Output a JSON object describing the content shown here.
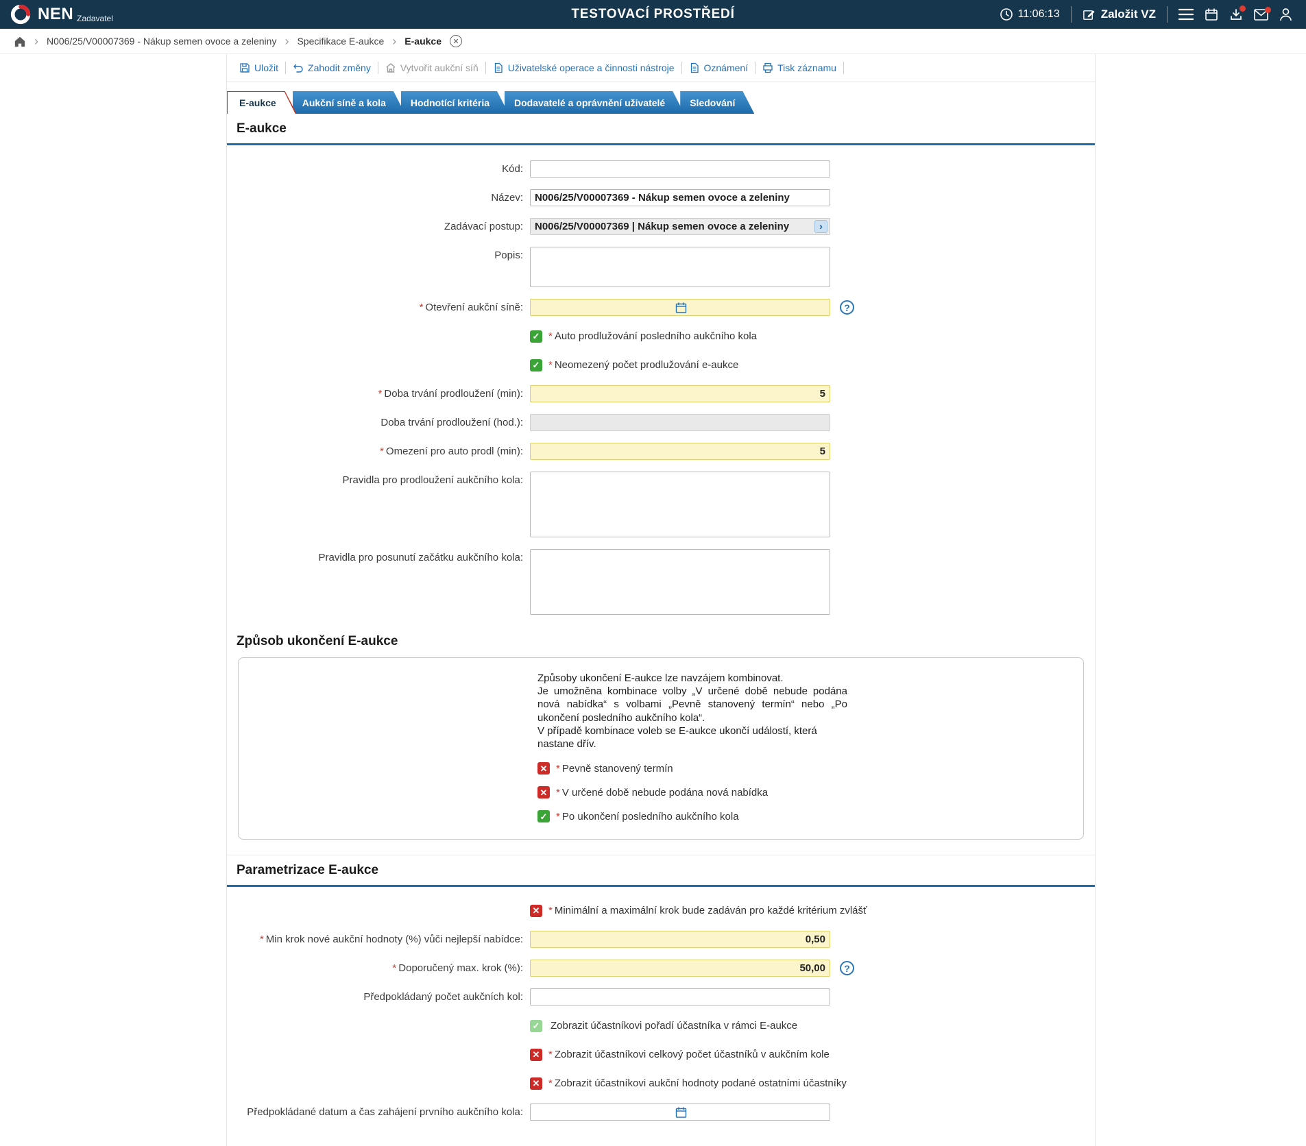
{
  "colors": {
    "header_bg": "#16364e",
    "accent_blue": "#1e6aab",
    "link_blue": "#2272b9",
    "active_tab_red": "#c23a2c",
    "required_field_bg": "#fcf5cb",
    "checkbox_yes_green": "#3aa437",
    "checkbox_no_red": "#cd2b27",
    "checkbox_disabled_green": "#97d694",
    "badge_red": "#e03c31"
  },
  "header": {
    "brand": "NEN",
    "brand_sub": "Zadavatel",
    "environment": "TESTOVACÍ PROSTŘEDÍ",
    "time": "11:06:13",
    "create_button": "Založit VZ",
    "icons": [
      "clock-icon",
      "edit-icon",
      "menu-icon",
      "calendar-icon",
      "download-icon",
      "mail-icon",
      "person-icon"
    ],
    "download_badge": true,
    "mail_badge": true
  },
  "breadcrumb": {
    "home_icon": "home-icon",
    "items": [
      {
        "label": "N006/25/V00007369 - Nákup semen ovoce a zeleniny",
        "current": false
      },
      {
        "label": "Specifikace E-aukce",
        "current": false
      },
      {
        "label": "E-aukce",
        "current": true
      }
    ],
    "close_icon": "close-circle-icon"
  },
  "toolbar": {
    "items": [
      {
        "label": "Uložit",
        "icon": "save-icon",
        "disabled": false
      },
      {
        "label": "Zahodit změny",
        "icon": "undo-icon",
        "disabled": false
      },
      {
        "label": "Vytvořit aukční síň",
        "icon": "auction-room-icon",
        "disabled": true
      },
      {
        "label": "Uživatelské operace a činnosti nástroje",
        "icon": "document-icon",
        "disabled": false
      },
      {
        "label": "Oznámení",
        "icon": "document-icon",
        "disabled": false
      },
      {
        "label": "Tisk záznamu",
        "icon": "printer-icon",
        "disabled": false
      }
    ]
  },
  "tabs": [
    {
      "label": "E-aukce",
      "active": true
    },
    {
      "label": "Aukční síně a kola",
      "active": false
    },
    {
      "label": "Hodnotící kritéria",
      "active": false
    },
    {
      "label": "Dodavatelé a oprávnění uživatelé",
      "active": false
    },
    {
      "label": "Sledování",
      "active": false
    }
  ],
  "sections": {
    "eaukce": "E-aukce",
    "zpusob": "Způsob ukončení E-aukce",
    "parametrizace": "Parametrizace E-aukce"
  },
  "fields": {
    "kod": {
      "label": "Kód:",
      "value": ""
    },
    "nazev": {
      "label": "Název:",
      "value": "N006/25/V00007369 - Nákup semen ovoce a zeleniny"
    },
    "zadavaci_postup": {
      "label": "Zadávací postup:",
      "value": "N006/25/V00007369 | Nákup semen ovoce a zeleniny"
    },
    "popis": {
      "label": "Popis:",
      "value": ""
    },
    "otevreni_sine": {
      "label": "Otevření aukční síně:",
      "value": "",
      "required": "*"
    },
    "doba_trvani_min": {
      "label": "Doba trvání prodloužení (min):",
      "value": "5",
      "required": "*"
    },
    "doba_trvani_hod": {
      "label": "Doba trvání prodloužení (hod.):",
      "value": ""
    },
    "omezeni_auto": {
      "label": "Omezení pro auto prodl (min):",
      "value": "5",
      "required": "*"
    },
    "pravidla_prodlouzeni": {
      "label": "Pravidla pro prodloužení aukčního kola:",
      "value": ""
    },
    "pravidla_posunuti": {
      "label": "Pravidla pro posunutí začátku aukčního kola:",
      "value": ""
    },
    "min_krok": {
      "label": "Min krok nové aukční hodnoty (%) vůči nejlepší nabídce:",
      "value": "0,50",
      "required": "*"
    },
    "max_krok": {
      "label": "Doporučený max. krok (%):",
      "value": "50,00",
      "required": "*"
    },
    "pocet_kol": {
      "label": "Předpokládaný počet aukčních kol:",
      "value": ""
    },
    "datum_zahajeni": {
      "label": "Předpokládané datum a čas zahájení prvního aukčního kola:",
      "value": ""
    }
  },
  "checkboxes": {
    "auto_prodl": {
      "label": "Auto prodlužování posledního aukčního kola",
      "state": "yes",
      "required": "*"
    },
    "neomezeny": {
      "label": "Neomezený počet prodlužování e-aukce",
      "state": "yes",
      "required": "*"
    },
    "pevny_termin": {
      "label": "Pevně stanovený termín",
      "state": "no",
      "required": "*"
    },
    "urcena_doba": {
      "label": "V určené době nebude podána nová nabídka",
      "state": "no",
      "required": "*"
    },
    "po_ukonceni": {
      "label": "Po ukončení posledního aukčního kola",
      "state": "yes",
      "required": "*"
    },
    "min_max_krok": {
      "label": "Minimální a maximální krok bude zadáván pro každé kritérium zvlášť",
      "state": "no",
      "required": "*"
    },
    "poradi": {
      "label": "Zobrazit účastníkovi pořadí účastníka v rámci E-aukce",
      "state": "yes-disabled"
    },
    "celkovy_pocet": {
      "label": "Zobrazit účastníkovi celkový počet účastníků v aukčním kole",
      "state": "no",
      "required": "*"
    },
    "aukcni_hodnoty": {
      "label": "Zobrazit účastníkovi aukční hodnoty podané ostatními účastníky",
      "state": "no",
      "required": "*"
    }
  },
  "info": {
    "p1": "Způsoby ukončení E-aukce lze navzájem kombinovat.",
    "p2": "Je umožněna kombinace volby „V určené době nebude podána nová nabídka“ s volbami „Pevně stanovený termín“ nebo „Po ukončení posledního aukčního kola“.",
    "p3": "V případě kombinace voleb se E-aukce ukončí událostí, která nastane dřív."
  }
}
